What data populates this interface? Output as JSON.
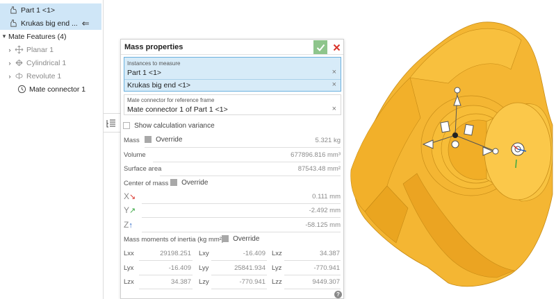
{
  "tree": {
    "part1": "Part 1 <1>",
    "krukas": "Krukas big end ...",
    "mate_features": "Mate Features (4)",
    "planar": "Planar 1",
    "cylindrical": "Cylindrical 1",
    "revolute": "Revolute 1",
    "mate_connector": "Mate connector 1"
  },
  "dialog": {
    "title": "Mass properties",
    "instances_caption": "Instances to measure",
    "instances": [
      "Part 1 <1>",
      "Krukas big end <1>"
    ],
    "ref_caption": "Mate connector for reference frame",
    "ref_value": "Mate connector 1 of Part 1 <1>",
    "show_variance": "Show calculation variance",
    "mass_label": "Mass",
    "override_label": "Override",
    "mass_value": "5.321 kg",
    "volume_label": "Volume",
    "volume_value": "677896.816 mm³",
    "area_label": "Surface area",
    "area_value": "87543.48 mm²",
    "com_label": "Center of mass",
    "x_axis": "X",
    "y_axis": "Y",
    "z_axis": "Z",
    "x_arrow": "↘",
    "y_arrow": "↗",
    "z_arrow": "↑",
    "com_x": "0.111 mm",
    "com_y": "-2.492 mm",
    "com_z": "-58.125 mm",
    "moi_label": "Mass moments of inertia (kg mm²)",
    "lxx": "Lxx",
    "lxy": "Lxy",
    "lxz": "Lxz",
    "lyx": "Lyx",
    "lyy": "Lyy",
    "lyz": "Lyz",
    "lzx": "Lzx",
    "lzy": "Lzy",
    "lzz": "Lzz",
    "lxx_v": "29198.251",
    "lxy_v": "-16.409",
    "lxz_v": "34.387",
    "lyx_v": "-16.409",
    "lyy_v": "25841.934",
    "lyz_v": "-770.941",
    "lzx_v": "34.387",
    "lzy_v": "-770.941",
    "lzz_v": "9449.307",
    "help": "?"
  },
  "colors": {
    "selection_blue": "#cfe6f7",
    "ok_green": "#8ec58c",
    "cancel_red": "#d9342b",
    "part_yellow": "#f5b932",
    "x_red": "#d9342b",
    "y_green": "#3aa843",
    "z_blue": "#1f5fc4"
  }
}
